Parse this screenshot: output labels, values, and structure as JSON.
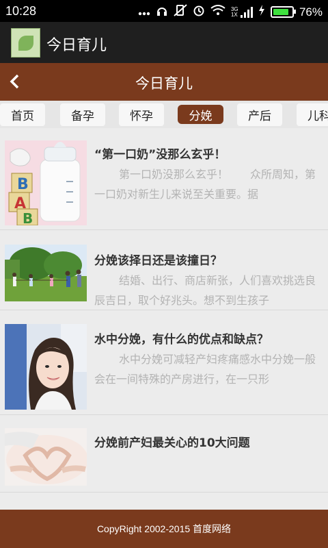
{
  "status_bar": {
    "time": "10:28",
    "network": "3G 1X",
    "battery": "76%",
    "icons": [
      "more-dots-icon",
      "headset-icon",
      "vibrate-icon",
      "alarm-icon",
      "wifi-icon",
      "signal-icon",
      "charging-icon",
      "battery-icon"
    ]
  },
  "app_bar": {
    "title": "今日育儿",
    "logo_icon": "app-logo-icon"
  },
  "nav": {
    "title": "今日育儿",
    "back_icon": "chevron-left-icon"
  },
  "tabs": [
    {
      "label": "首页",
      "active": false
    },
    {
      "label": "备孕",
      "active": false
    },
    {
      "label": "怀孕",
      "active": false
    },
    {
      "label": "分娩",
      "active": true
    },
    {
      "label": "产后",
      "active": false
    },
    {
      "label": "儿科",
      "active": false
    }
  ],
  "articles": [
    {
      "title": "“第一口奶”没那么玄乎！",
      "desc": "第一口奶没那么玄乎！　　众所周知，第一口奶对新生儿来说至关重要。据"
    },
    {
      "title": "分娩该择日还是该撞日？",
      "desc": "结婚、出行、商店新张，人们喜欢挑选良辰吉日，取个好兆头。想不到生孩子"
    },
    {
      "title": "水中分娩，有什么的优点和缺点？",
      "desc": "水中分娩可减轻产妇疼痛感水中分娩一般会在一间特殊的产房进行，在一只形"
    },
    {
      "title": "分娩前产妇最关心的10大问题",
      "desc": ""
    }
  ],
  "footer": {
    "text": "CopyRight 2002-2015 首度网络"
  },
  "colors": {
    "brand": "#7a3a1d",
    "app_bar": "#1f1f1f",
    "battery": "#3ee03e"
  }
}
